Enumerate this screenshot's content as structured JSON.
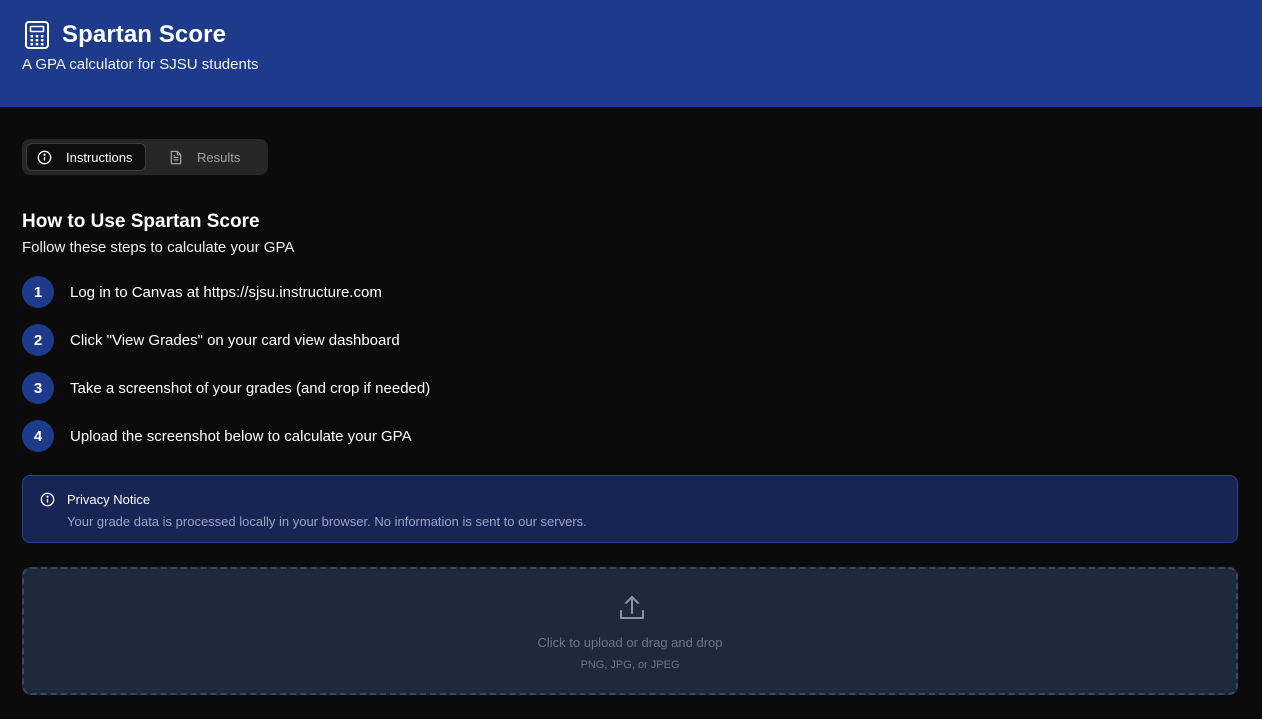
{
  "header": {
    "title": "Spartan Score",
    "subtitle": "A GPA calculator for SJSU students",
    "icon": "calculator-icon",
    "background": "#1e3a8a"
  },
  "tabs": [
    {
      "label": "Instructions",
      "icon": "info-icon",
      "active": true
    },
    {
      "label": "Results",
      "icon": "document-icon",
      "active": false
    }
  ],
  "howto": {
    "title": "How to Use Spartan Score",
    "subtitle": "Follow these steps to calculate your GPA",
    "steps": [
      {
        "number": "1",
        "text": "Log in to Canvas at https://sjsu.instructure.com"
      },
      {
        "number": "2",
        "text": "Click \"View Grades\" on your card view dashboard"
      },
      {
        "number": "3",
        "text": "Take a screenshot of your grades (and crop if needed)"
      },
      {
        "number": "4",
        "text": "Upload the screenshot below to calculate your GPA"
      }
    ]
  },
  "notice": {
    "icon": "info-icon",
    "title": "Privacy Notice",
    "body": "Your grade data is processed locally in your browser. No information is sent to our servers."
  },
  "upload": {
    "icon": "upload-icon",
    "label": "Click to upload or drag and drop",
    "formats": "PNG, JPG, or JPEG"
  }
}
